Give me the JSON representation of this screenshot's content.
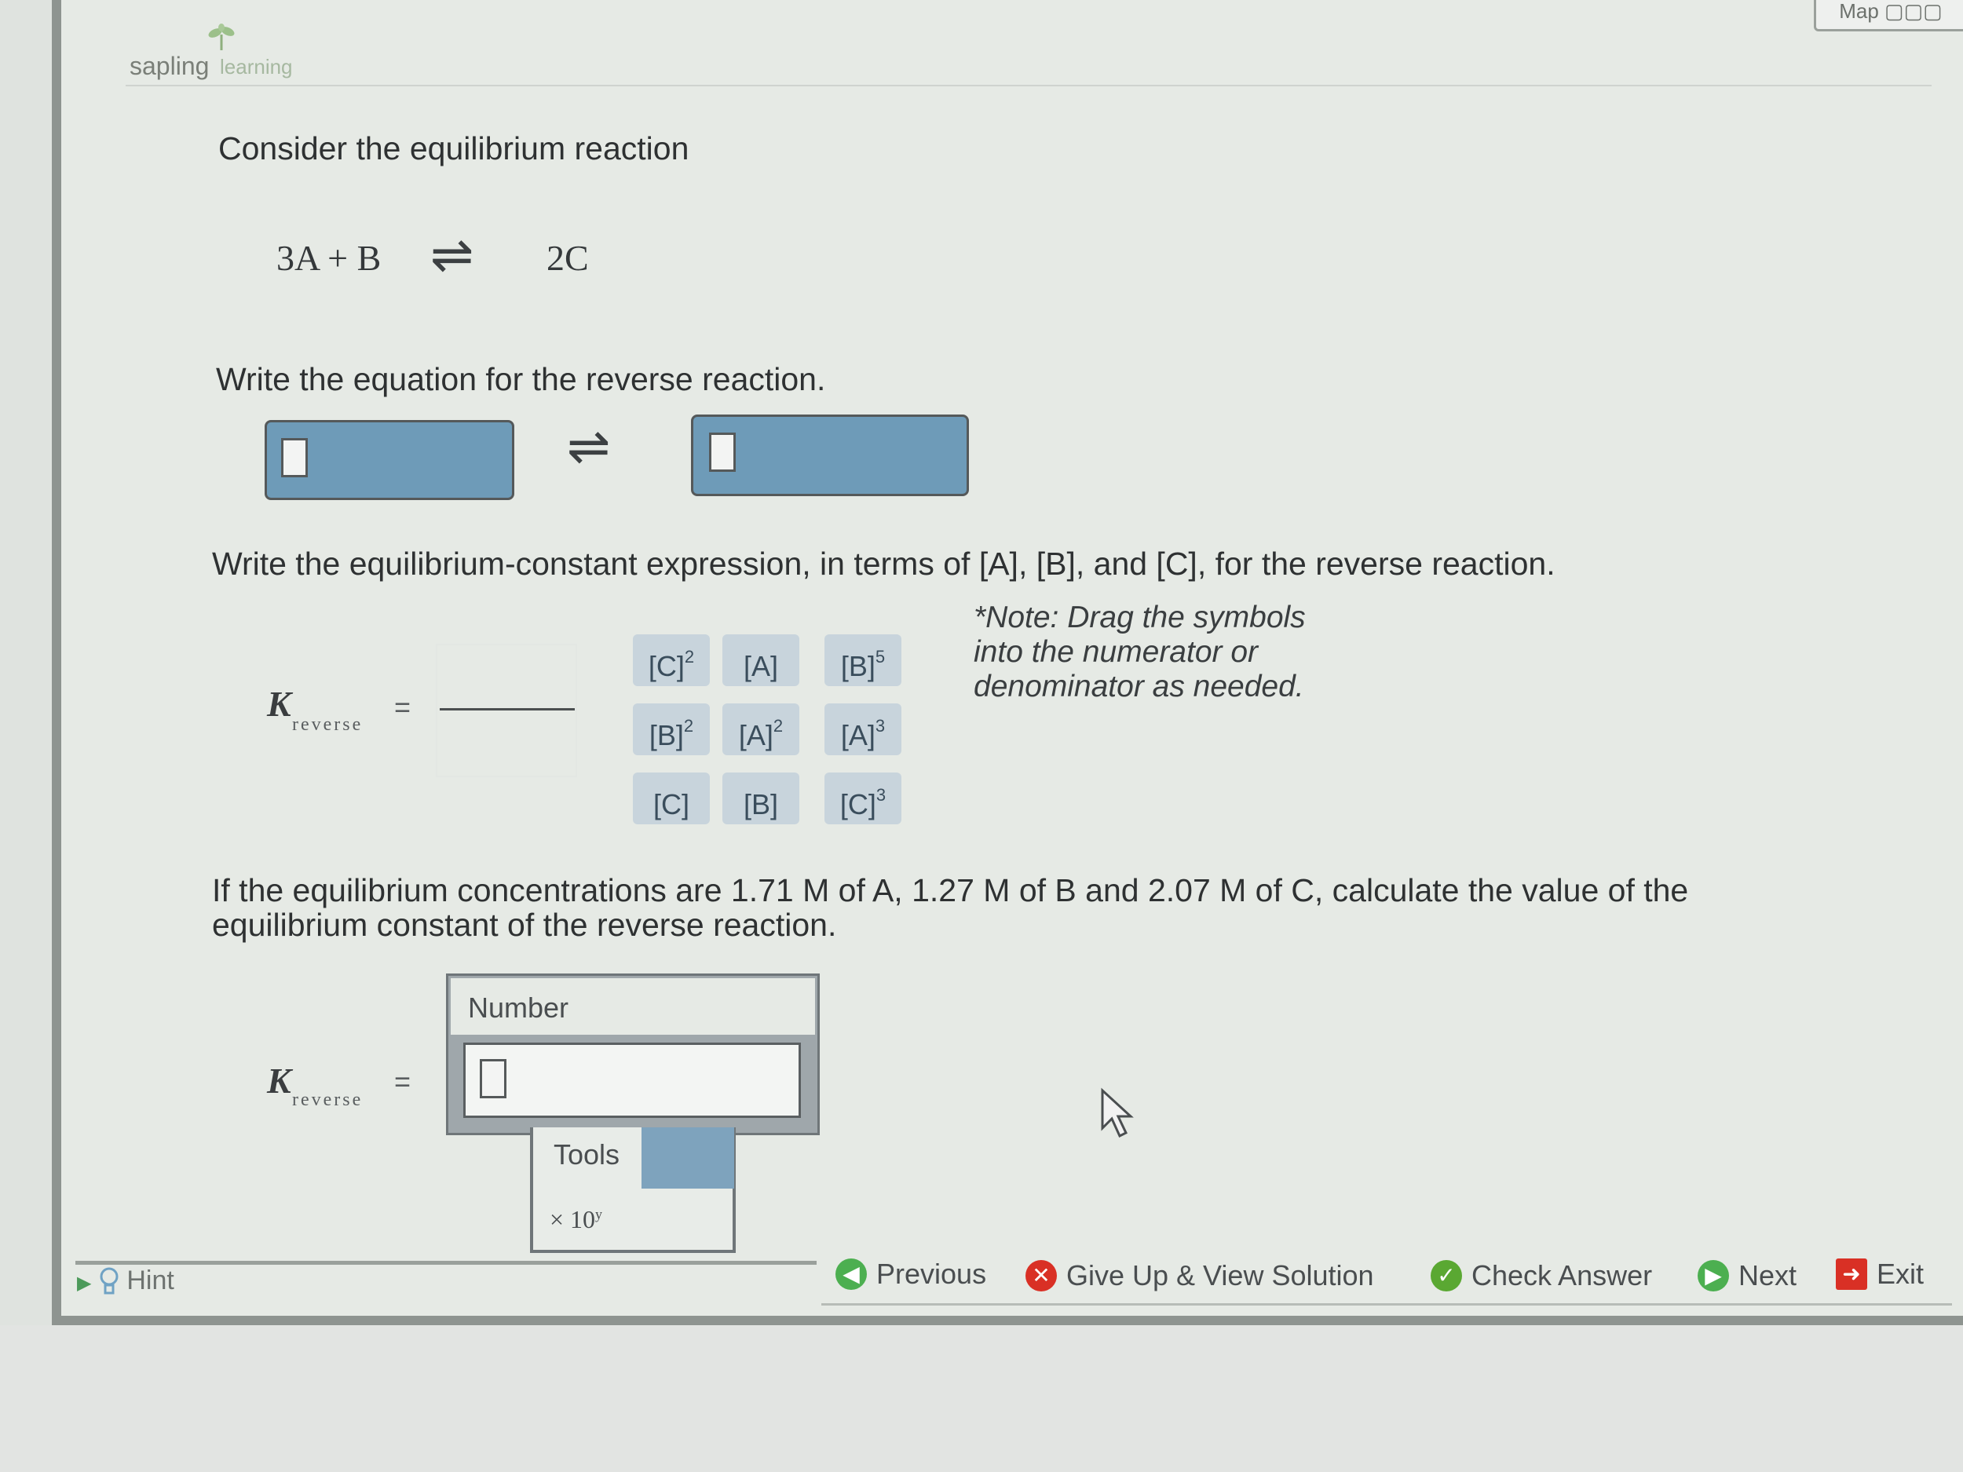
{
  "header": {
    "logo_primary": "sapling",
    "logo_secondary": "learning",
    "map_label": "Map"
  },
  "question": {
    "intro": "Consider the equilibrium reaction",
    "reaction_left": "3A + B",
    "reaction_arrow": "⇌",
    "reaction_right": "2C",
    "part1_prompt": "Write the equation for the reverse reaction.",
    "part1_arrow": "⇌",
    "part2_prompt": "Write the equilibrium-constant expression, in terms of [A], [B], and [C], for the reverse reaction.",
    "part3_prompt_line1": "If the equilibrium concentrations are 1.71 M of A, 1.27 M of B and 2.07 M of C, calculate the value of the",
    "part3_prompt_line2": "equilibrium constant of the reverse reaction."
  },
  "k_expression": {
    "k_symbol": "K",
    "k_subscript": "reverse",
    "equals": "="
  },
  "tiles": [
    {
      "base": "[C]",
      "exp": "2"
    },
    {
      "base": "[A]",
      "exp": ""
    },
    {
      "base": "[B]",
      "exp": "5"
    },
    {
      "base": "[B]",
      "exp": "2"
    },
    {
      "base": "[A]",
      "exp": "2"
    },
    {
      "base": "[A]",
      "exp": "3"
    },
    {
      "base": "[C]",
      "exp": ""
    },
    {
      "base": "[B]",
      "exp": ""
    },
    {
      "base": "[C]",
      "exp": "3"
    }
  ],
  "note": {
    "line1": "*Note: Drag the symbols",
    "line2": "into the numerator or",
    "line3": "denominator as needed."
  },
  "number_input": {
    "label": "Number",
    "value": "",
    "tools_label": "Tools",
    "tools_item": "× 10",
    "tools_item_exp": "y"
  },
  "footer": {
    "hint_label": "Hint",
    "previous_label": "Previous",
    "giveup_label": "Give Up & View Solution",
    "check_label": "Check Answer",
    "next_label": "Next",
    "exit_label": "Exit"
  },
  "colors": {
    "drop_zone_blue": "#6e9bb8",
    "tile_bg": "#c8d4dc",
    "previous_icon": "#4caf50",
    "giveup_icon": "#d93025",
    "check_icon": "#5aa832",
    "next_icon": "#4caf50",
    "exit_icon": "#d93025"
  },
  "icons": [
    "sapling-leaf-icon",
    "map-icon",
    "hint-bulb-icon",
    "previous-icon",
    "giveup-icon",
    "check-icon",
    "next-icon",
    "exit-icon",
    "mouse-cursor-icon"
  ]
}
